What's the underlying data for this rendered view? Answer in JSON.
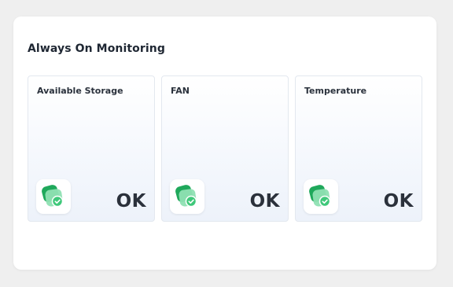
{
  "panel": {
    "title": "Always On Monitoring",
    "cards": [
      {
        "label": "Available Storage",
        "status": "OK",
        "icon": "check-shield-icon"
      },
      {
        "label": "FAN",
        "status": "OK",
        "icon": "check-shield-icon"
      },
      {
        "label": "Temperature",
        "status": "OK",
        "icon": "check-shield-icon"
      }
    ]
  },
  "colors": {
    "accent_green": "#2fbf6e",
    "accent_green_light": "#8fe0b3",
    "text_dark": "#2b313b"
  }
}
